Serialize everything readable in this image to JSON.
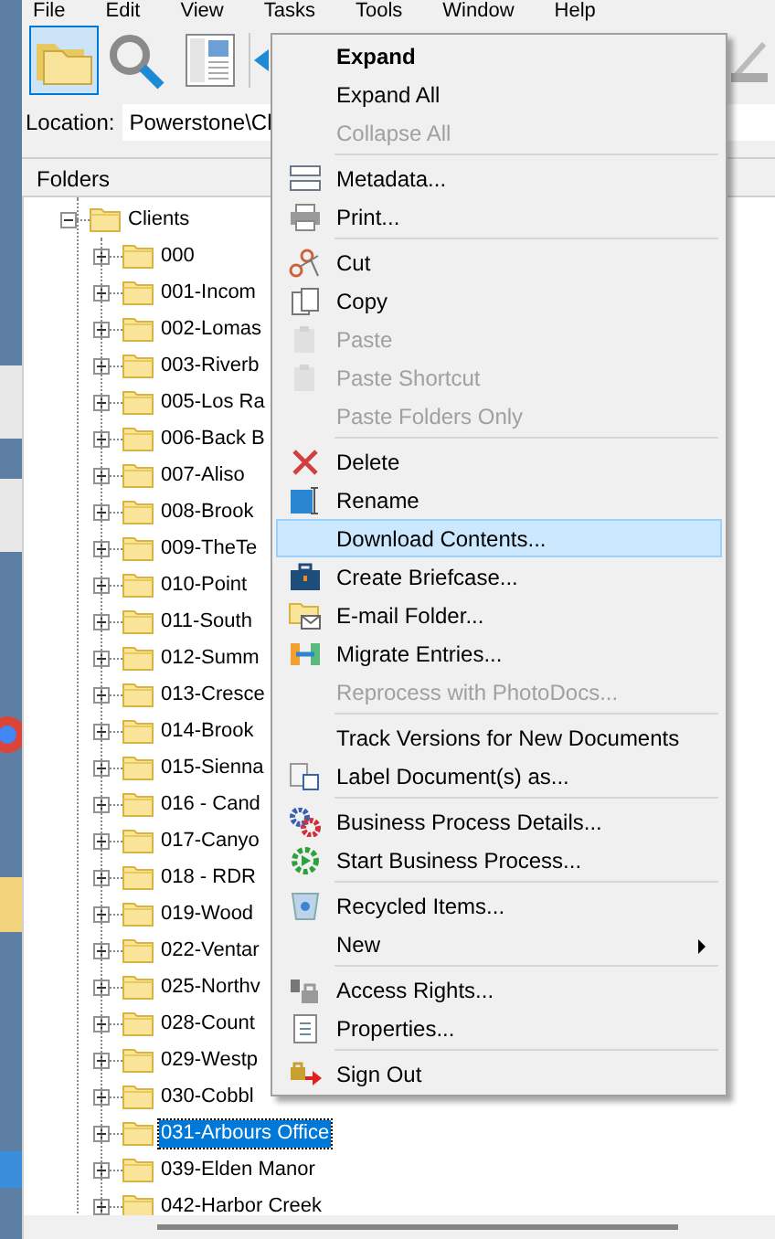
{
  "menubar": [
    "File",
    "Edit",
    "View",
    "Tasks",
    "Tools",
    "Window",
    "Help"
  ],
  "toolbar": [
    {
      "selected": true
    },
    {
      "selected": false
    },
    {
      "selected": false
    }
  ],
  "location": {
    "label": "Location:",
    "value": "Powerstone\\Cl"
  },
  "folders_header": "Folders",
  "tree": [
    {
      "label": "Clients",
      "expanded": true,
      "selected": false,
      "children": [
        {
          "label": "000",
          "expanded": false,
          "selected": false
        },
        {
          "label": "001-Incom",
          "expanded": false,
          "selected": false
        },
        {
          "label": "002-Lomas",
          "expanded": false,
          "selected": false
        },
        {
          "label": "003-Riverb",
          "expanded": false,
          "selected": false
        },
        {
          "label": "005-Los Ra",
          "expanded": false,
          "selected": false
        },
        {
          "label": "006-Back B",
          "expanded": false,
          "selected": false
        },
        {
          "label": "007-Aliso",
          "expanded": false,
          "selected": false
        },
        {
          "label": "008-Brook",
          "expanded": false,
          "selected": false
        },
        {
          "label": "009-TheTe",
          "expanded": false,
          "selected": false
        },
        {
          "label": "010-Point",
          "expanded": false,
          "selected": false
        },
        {
          "label": "011-South",
          "expanded": false,
          "selected": false
        },
        {
          "label": "012-Summ",
          "expanded": false,
          "selected": false
        },
        {
          "label": "013-Cresce",
          "expanded": false,
          "selected": false
        },
        {
          "label": "014-Brook",
          "expanded": false,
          "selected": false
        },
        {
          "label": "015-Sienna",
          "expanded": false,
          "selected": false
        },
        {
          "label": "016 - Cand",
          "expanded": false,
          "selected": false
        },
        {
          "label": "017-Canyo",
          "expanded": false,
          "selected": false
        },
        {
          "label": "018 - RDR",
          "expanded": false,
          "selected": false
        },
        {
          "label": "019-Wood",
          "expanded": false,
          "selected": false
        },
        {
          "label": "022-Ventar",
          "expanded": false,
          "selected": false
        },
        {
          "label": "025-Northv",
          "expanded": false,
          "selected": false
        },
        {
          "label": "028-Count",
          "expanded": false,
          "selected": false
        },
        {
          "label": "029-Westp",
          "expanded": false,
          "selected": false
        },
        {
          "label": "030-Cobbl",
          "expanded": false,
          "selected": false
        },
        {
          "label": "031-Arbours Office",
          "expanded": false,
          "selected": true
        },
        {
          "label": "039-Elden Manor",
          "expanded": false,
          "selected": false
        },
        {
          "label": "042-Harbor Creek",
          "expanded": false,
          "selected": false
        }
      ]
    }
  ],
  "context_menu": [
    {
      "kind": "item",
      "label": "Expand",
      "default": true,
      "disabled": false,
      "selected": false
    },
    {
      "kind": "item",
      "label": "Expand All",
      "default": false,
      "disabled": false,
      "selected": false
    },
    {
      "kind": "item",
      "label": "Collapse All",
      "default": false,
      "disabled": true,
      "selected": false
    },
    {
      "kind": "separator"
    },
    {
      "kind": "item",
      "label": "Metadata...",
      "default": false,
      "disabled": false,
      "selected": false
    },
    {
      "kind": "item",
      "label": "Print...",
      "default": false,
      "disabled": false,
      "selected": false
    },
    {
      "kind": "separator"
    },
    {
      "kind": "item",
      "label": "Cut",
      "default": false,
      "disabled": false,
      "selected": false
    },
    {
      "kind": "item",
      "label": "Copy",
      "default": false,
      "disabled": false,
      "selected": false
    },
    {
      "kind": "item",
      "label": "Paste",
      "default": false,
      "disabled": true,
      "selected": false
    },
    {
      "kind": "item",
      "label": "Paste Shortcut",
      "default": false,
      "disabled": true,
      "selected": false
    },
    {
      "kind": "item",
      "label": "Paste Folders Only",
      "default": false,
      "disabled": true,
      "selected": false
    },
    {
      "kind": "separator"
    },
    {
      "kind": "item",
      "label": "Delete",
      "default": false,
      "disabled": false,
      "selected": false
    },
    {
      "kind": "item",
      "label": "Rename",
      "default": false,
      "disabled": false,
      "selected": false
    },
    {
      "kind": "item",
      "label": "Download Contents...",
      "default": false,
      "disabled": false,
      "selected": true
    },
    {
      "kind": "item",
      "label": "Create Briefcase...",
      "default": false,
      "disabled": false,
      "selected": false
    },
    {
      "kind": "item",
      "label": "E-mail Folder...",
      "default": false,
      "disabled": false,
      "selected": false
    },
    {
      "kind": "item",
      "label": "Migrate Entries...",
      "default": false,
      "disabled": false,
      "selected": false
    },
    {
      "kind": "item",
      "label": "Reprocess with PhotoDocs...",
      "default": false,
      "disabled": true,
      "selected": false
    },
    {
      "kind": "separator"
    },
    {
      "kind": "item",
      "label": "Track Versions for New Documents",
      "default": false,
      "disabled": false,
      "selected": false
    },
    {
      "kind": "item",
      "label": "Label Document(s) as...",
      "default": false,
      "disabled": false,
      "selected": false
    },
    {
      "kind": "separator"
    },
    {
      "kind": "item",
      "label": "Business Process Details...",
      "default": false,
      "disabled": false,
      "selected": false
    },
    {
      "kind": "item",
      "label": "Start Business Process...",
      "default": false,
      "disabled": false,
      "selected": false
    },
    {
      "kind": "separator"
    },
    {
      "kind": "item",
      "label": "Recycled Items...",
      "default": false,
      "disabled": false,
      "selected": false
    },
    {
      "kind": "submenu",
      "label": "New",
      "default": false,
      "disabled": false,
      "selected": false
    },
    {
      "kind": "separator"
    },
    {
      "kind": "item",
      "label": "Access Rights...",
      "default": false,
      "disabled": false,
      "selected": false
    },
    {
      "kind": "item",
      "label": "Properties...",
      "default": false,
      "disabled": false,
      "selected": false
    },
    {
      "kind": "separator"
    },
    {
      "kind": "item",
      "label": "Sign Out",
      "default": false,
      "disabled": false,
      "selected": false
    }
  ]
}
